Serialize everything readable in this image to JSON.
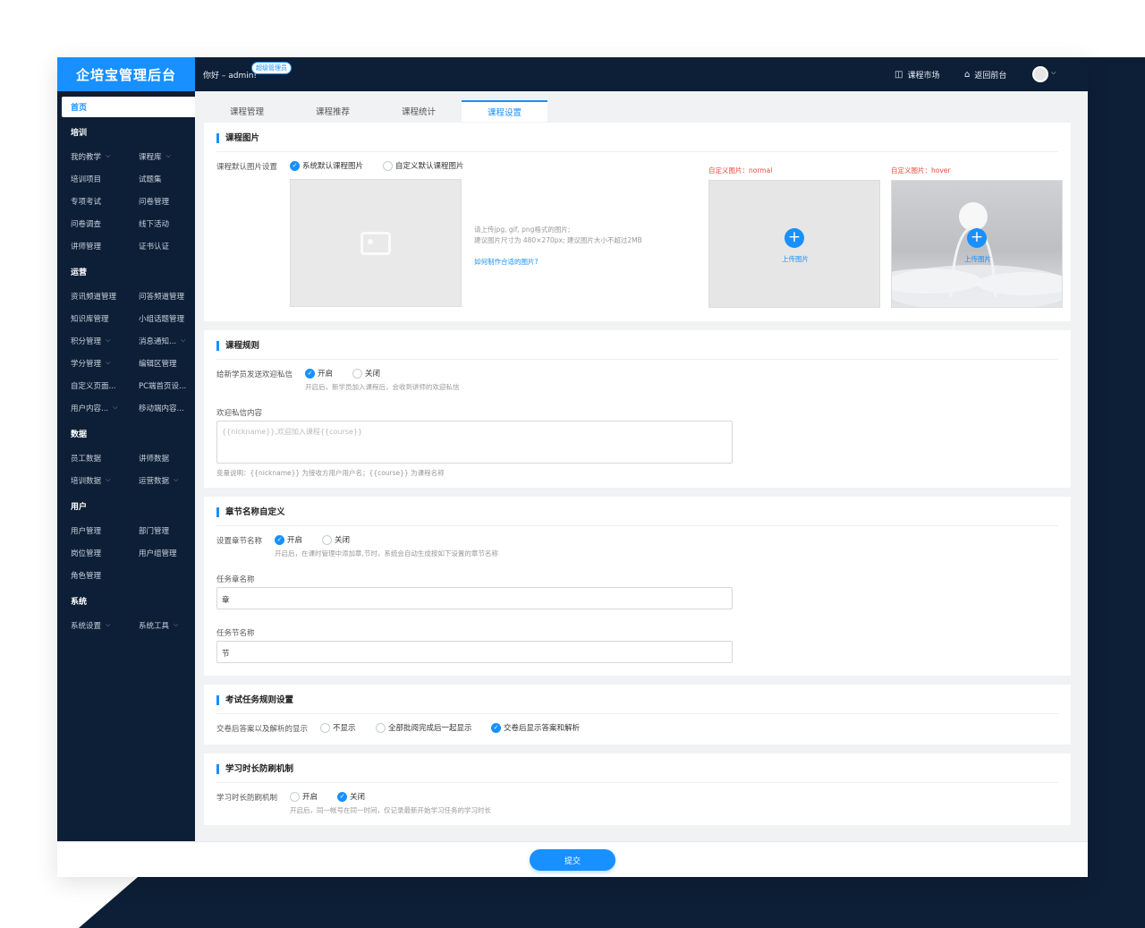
{
  "app": {
    "title": "企培宝管理后台",
    "greeting": "你好 – admin!",
    "role_badge": "超级管理员"
  },
  "header": {
    "market": "课程市场",
    "front": "返回前台"
  },
  "sidebar": {
    "home": "首页",
    "sections": [
      {
        "title": "培训",
        "items": [
          {
            "label": "我的教学",
            "chev": true
          },
          {
            "label": "课程库",
            "chev": true
          },
          {
            "label": "培训项目"
          },
          {
            "label": "试题集"
          },
          {
            "label": "专项考试"
          },
          {
            "label": "问卷管理"
          },
          {
            "label": "问卷调查"
          },
          {
            "label": "线下活动"
          },
          {
            "label": "讲师管理"
          },
          {
            "label": "证书认证"
          }
        ]
      },
      {
        "title": "运营",
        "items": [
          {
            "label": "资讯频道管理"
          },
          {
            "label": "问答频道管理"
          },
          {
            "label": "知识库管理"
          },
          {
            "label": "小组话题管理"
          },
          {
            "label": "积分管理",
            "chev": true
          },
          {
            "label": "消息通知...",
            "chev": true
          },
          {
            "label": "学分管理",
            "chev": true
          },
          {
            "label": "编辑区管理"
          },
          {
            "label": "自定义页面..."
          },
          {
            "label": "PC端首页设..."
          },
          {
            "label": "用户内容...",
            "chev": true
          },
          {
            "label": "移动端内容..."
          }
        ]
      },
      {
        "title": "数据",
        "items": [
          {
            "label": "员工数据"
          },
          {
            "label": "讲师数据"
          },
          {
            "label": "培训数据",
            "chev": true
          },
          {
            "label": "运营数据",
            "chev": true
          }
        ]
      },
      {
        "title": "用户",
        "items": [
          {
            "label": "用户管理"
          },
          {
            "label": "部门管理"
          },
          {
            "label": "岗位管理"
          },
          {
            "label": "用户组管理"
          },
          {
            "label": "角色管理"
          }
        ]
      },
      {
        "title": "系统",
        "items": [
          {
            "label": "系统设置",
            "chev": true
          },
          {
            "label": "系统工具",
            "chev": true
          }
        ]
      }
    ]
  },
  "tabs": [
    "课程管理",
    "课程推荐",
    "课程统计",
    "课程设置"
  ],
  "course_image": {
    "title": "课程图片",
    "label": "课程默认图片设置",
    "opt_default": "系统默认课程图片",
    "opt_custom": "自定义默认课程图片",
    "hint1": "请上传jpg, gif, png格式的图片;",
    "hint2": "建议图片尺寸为 480×270px; 建议图片大小不超过2MB",
    "how_link": "如何制作合适的图片?",
    "normal_label": "自定义图片：normal",
    "hover_label": "自定义图片：hover",
    "upload": "上传图片"
  },
  "course_rules": {
    "title": "课程规则",
    "label": "给新学员发送欢迎私信",
    "on": "开启",
    "off": "关闭",
    "hint": "开启后，新学员加入课程后，会收到讲师的欢迎私信",
    "msg_label": "欢迎私信内容",
    "msg_placeholder": "{{nickname}},欢迎加入课程{{course}}",
    "var_hint": "变量说明：{{nickname}} 为接收方用户用户名；{{course}} 为课程名称"
  },
  "chapter": {
    "title": "章节名称自定义",
    "label": "设置章节名称",
    "on": "开启",
    "off": "关闭",
    "hint": "开启后，在课时管理中添加章,节时，系统会自动生成按如下设置的章节名称",
    "chapter_label": "任务章名称",
    "chapter_value": "章",
    "section_label": "任务节名称",
    "section_value": "节"
  },
  "exam": {
    "title": "考试任务规则设置",
    "label": "交卷后答案以及解析的显示",
    "opt1": "不显示",
    "opt2": "全部批阅完成后一起显示",
    "opt3": "交卷后显示答案和解析"
  },
  "anti": {
    "title": "学习时长防刷机制",
    "label": "学习时长防刷机制",
    "on": "开启",
    "off": "关闭",
    "hint": "开启后，同一帐号在同一时间，仅记录最新开始学习任务的学习时长"
  },
  "footer": {
    "submit": "提交"
  }
}
